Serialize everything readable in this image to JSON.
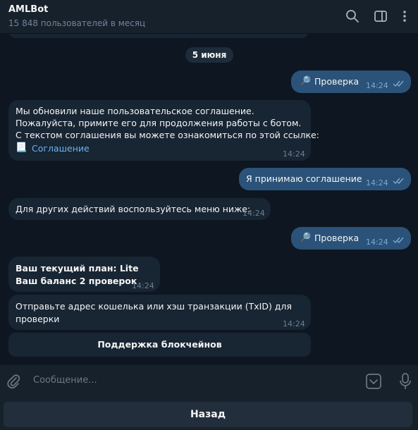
{
  "header": {
    "title": "AMLBot",
    "subtitle": "15 848 пользователей в месяц"
  },
  "chat": {
    "date": "5 июня",
    "messages": [
      {
        "direction": "out",
        "icon": "🔎",
        "text": "Проверка",
        "time": "14:24"
      },
      {
        "direction": "in",
        "lines": [
          "Мы обновили наше пользовательское соглашение.",
          "Пожалуйста, примите его для продолжения работы с ботом.",
          "С текстом соглашения вы можете ознакомиться по этой ссылке:"
        ],
        "link_icon": "📃",
        "link": "Соглашение",
        "time": "14:24"
      },
      {
        "direction": "out",
        "text": "Я принимаю соглашение",
        "time": "14:24"
      },
      {
        "direction": "in",
        "text": "Для других действий воспользуйтесь меню ниже:",
        "time": "14:24"
      },
      {
        "direction": "out",
        "icon": "🔎",
        "text": "Проверка",
        "time": "14:24"
      },
      {
        "direction": "in",
        "lines": [
          "Ваш текущий план: Lite",
          "Ваш баланс 2 проверок"
        ],
        "time": "14:24"
      },
      {
        "direction": "in",
        "lines": [
          "Отправьте адрес кошелька или хэш транзакции (TxID) для",
          "проверки"
        ],
        "time": "14:24"
      }
    ],
    "inline_button": "Поддержка блокчейнов"
  },
  "composer": {
    "placeholder": "Сообщение..."
  },
  "reply_keyboard": {
    "back_label": "Назад"
  },
  "icons": [
    "search-icon",
    "sidebar-toggle-icon",
    "more-vertical-icon",
    "attach-icon",
    "keyboard-toggle-icon",
    "microphone-icon",
    "double-check-icon"
  ],
  "colors": {
    "background": "#0e1621",
    "header": "#17212b",
    "incoming": "#182533",
    "outgoing": "#2b5278",
    "link": "#6ab3f3",
    "read_ticks": "#7da8d3"
  }
}
